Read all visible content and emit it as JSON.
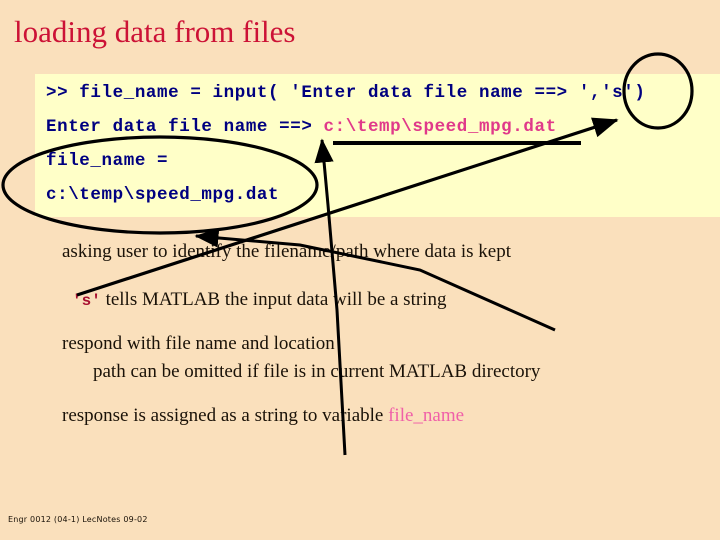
{
  "slide": {
    "title": "loading data from files",
    "background_color": "#fae0bc",
    "title_color": "#cc1236"
  },
  "code_box": {
    "background_color": "#ffffc8",
    "text_color": "#000080",
    "path_color": "#e0398a",
    "lines": [
      {
        "id": "prompt-command",
        "text": ">> file_name = input( 'Enter data file name ==> ','s')"
      },
      {
        "id": "prompt-echo",
        "prefix": "Enter data file name ==> ",
        "path": "c:\\temp\\speed_mpg.dat"
      },
      {
        "id": "result-varname",
        "text": "file_name ="
      },
      {
        "id": "result-value",
        "text": "c:\\temp\\speed_mpg.dat"
      }
    ]
  },
  "bullets": [
    {
      "id": "bullet-1",
      "text": "asking user to identify the filename/path where data is kept"
    },
    {
      "id": "bullet-2",
      "code": "'s'",
      "text": " tells MATLAB the input data will be a string"
    },
    {
      "id": "bullet-3",
      "text": "respond with file name and location"
    },
    {
      "id": "bullet-4",
      "text": "path can be omitted if file is in current MATLAB directory"
    },
    {
      "id": "bullet-5",
      "text": "response is assigned as a string to variable ",
      "variable": "file_name"
    }
  ],
  "annotations": {
    "circle_label": "string-flag-circle",
    "ellipse_label": "assigned-variable-ellipse",
    "arrow_count": 3,
    "stroke_color": "#000000"
  },
  "footer": {
    "text": "Engr 0012 (04-1) LecNotes 09-02"
  }
}
